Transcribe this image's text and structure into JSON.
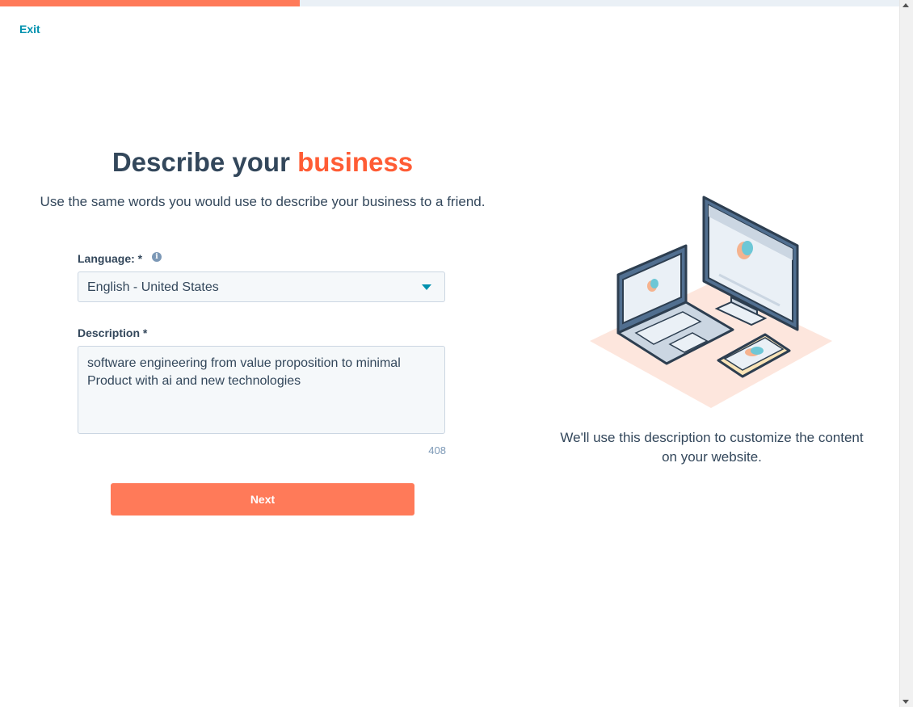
{
  "progress": {
    "fraction": 0.333
  },
  "header": {
    "exit_label": "Exit"
  },
  "main": {
    "title_plain": "Describe your",
    "title_accent": "business",
    "subtitle": "Use the same words you would use to describe your business to a friend."
  },
  "form": {
    "language_label": "Language: *",
    "language_value": "English - United States",
    "description_label": "Description *",
    "description_value": "software engineering from value proposition to minimal Product with ai and new technologies",
    "char_count": "408",
    "next_label": "Next"
  },
  "aside": {
    "helper_text": "We'll use this description to customize the content on your website."
  },
  "icons": {
    "info": "info-icon",
    "caret": "chevron-down-icon"
  },
  "colors": {
    "accent": "#ff5c35",
    "button": "#ff7a59",
    "link": "#0091ae",
    "text": "#33475b"
  }
}
